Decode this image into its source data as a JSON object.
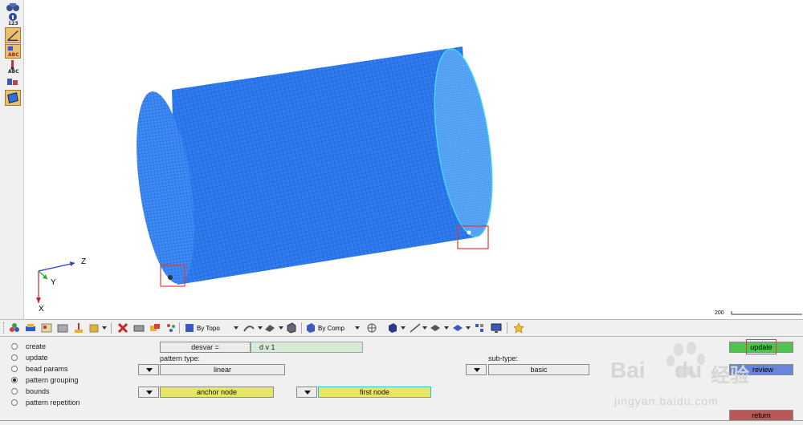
{
  "left_toolbar": {
    "label_123": "123",
    "label_abc_1": "ABC",
    "label_abc_2": "ABC"
  },
  "viewport": {
    "axis_z": "Z",
    "axis_y": "Y",
    "axis_x": "X",
    "scale_label": "200",
    "mesh_color": "#2f7df0",
    "mesh_edge_color": "#43d6e8"
  },
  "toolbar": {
    "topo_dropdown": "By Topo",
    "comp_dropdown": "By Comp"
  },
  "panel": {
    "modes": [
      {
        "label": "create",
        "selected": false
      },
      {
        "label": "update",
        "selected": false
      },
      {
        "label": "bead params",
        "selected": false
      },
      {
        "label": "pattern grouping",
        "selected": true
      },
      {
        "label": "bounds",
        "selected": false
      },
      {
        "label": "pattern repetition",
        "selected": false
      }
    ],
    "desvar_button": "desvar =",
    "desvar_value": "d  v  1",
    "pattern_type_label": "pattern type:",
    "pattern_type_value": "linear",
    "sub_type_label": "sub-type:",
    "sub_type_value": "basic",
    "anchor_node_button": "anchor node",
    "first_node_button": "first node",
    "update_button": "update",
    "review_button": "review",
    "return_button": "return"
  },
  "watermark": {
    "brand": "Bai",
    "brand_du": "du",
    "brand_cn": "经验",
    "url": "jingyan.baidu.com"
  }
}
